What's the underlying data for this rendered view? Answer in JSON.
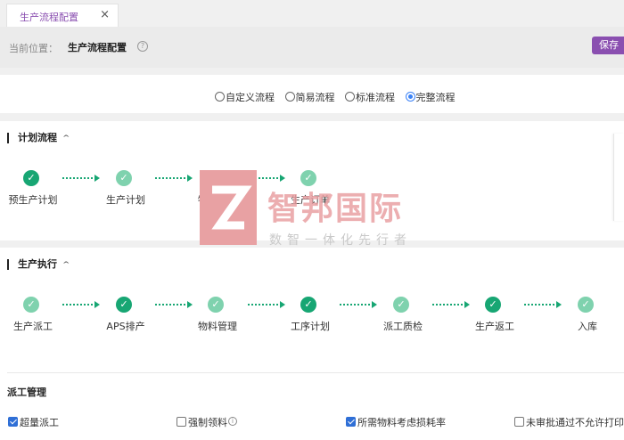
{
  "tab": {
    "label": "生产流程配置",
    "close": "×"
  },
  "breadcrumb": {
    "label": "当前位置：",
    "title": "生产流程配置",
    "help": "?"
  },
  "save_label": "保存",
  "flow_options": [
    {
      "label": "自定义流程",
      "selected": false
    },
    {
      "label": "简易流程",
      "selected": false
    },
    {
      "label": "标准流程",
      "selected": false
    },
    {
      "label": "完整流程",
      "selected": true
    }
  ],
  "plan_section": {
    "title": "计划流程",
    "chevron": "^",
    "steps": [
      {
        "label": "预生产计划",
        "state": "dark"
      },
      {
        "label": "生产计划",
        "state": "light"
      },
      {
        "label": "物料分析",
        "state": "dark"
      },
      {
        "label": "生产订单",
        "state": "light"
      }
    ]
  },
  "exec_section": {
    "title": "生产执行",
    "chevron": "^",
    "steps": [
      {
        "label": "生产派工",
        "state": "light"
      },
      {
        "label": "APS排产",
        "state": "dark"
      },
      {
        "label": "物料管理",
        "state": "light"
      },
      {
        "label": "工序计划",
        "state": "dark"
      },
      {
        "label": "派工质检",
        "state": "light"
      },
      {
        "label": "生产返工",
        "state": "dark"
      },
      {
        "label": "入库",
        "state": "light"
      }
    ]
  },
  "dispatch": {
    "title": "派工管理",
    "options": [
      {
        "label": "超量派工",
        "checked": true
      },
      {
        "label": "强制领料",
        "checked": false,
        "info": "i"
      },
      {
        "label": "所需物料考虑损耗率",
        "checked": true
      },
      {
        "label": "未审批通过不允许打印",
        "checked": false
      }
    ]
  },
  "watermark": {
    "brand": "智邦国际",
    "slogan": "数智一体化先行者"
  },
  "colors": {
    "accent": "#8a4fb0",
    "step_dark": "#17a673",
    "step_light": "#7fd2ae",
    "radio": "#3b82f6",
    "checkbox": "#2f6fd6"
  }
}
